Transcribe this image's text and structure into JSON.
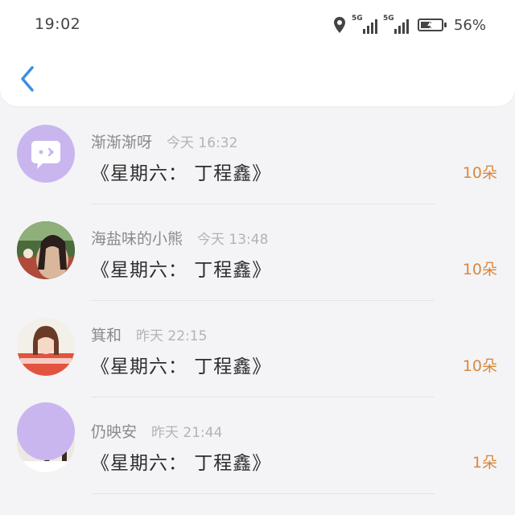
{
  "status_bar": {
    "time": "19:02",
    "network_1": "5G",
    "network_2": "5G",
    "battery_percent": "56%",
    "battery_level": 0.56
  },
  "header": {
    "back_icon": "chevron-left-icon",
    "accent_color": "#3d8fe0"
  },
  "messages": [
    {
      "name": "渐渐渐呀",
      "time": "今天 16:32",
      "title": "《星期六： 丁程鑫》",
      "count": "10朵",
      "avatar": "chat-bubble-icon"
    },
    {
      "name": "海盐味的小熊",
      "time": "今天 13:48",
      "title": "《星期六： 丁程鑫》",
      "count": "10朵",
      "avatar": "user-photo"
    },
    {
      "name": "箕和",
      "time": "昨天 22:15",
      "title": "《星期六： 丁程鑫》",
      "count": "10朵",
      "avatar": "user-photo"
    },
    {
      "name": "仍映安",
      "time": "昨天 21:44",
      "title": "《星期六： 丁程鑫》",
      "count": "1朵",
      "avatar": "user-photo"
    }
  ],
  "colors": {
    "count": "#d9883d",
    "avatar_purple": "#c9b6ef"
  }
}
